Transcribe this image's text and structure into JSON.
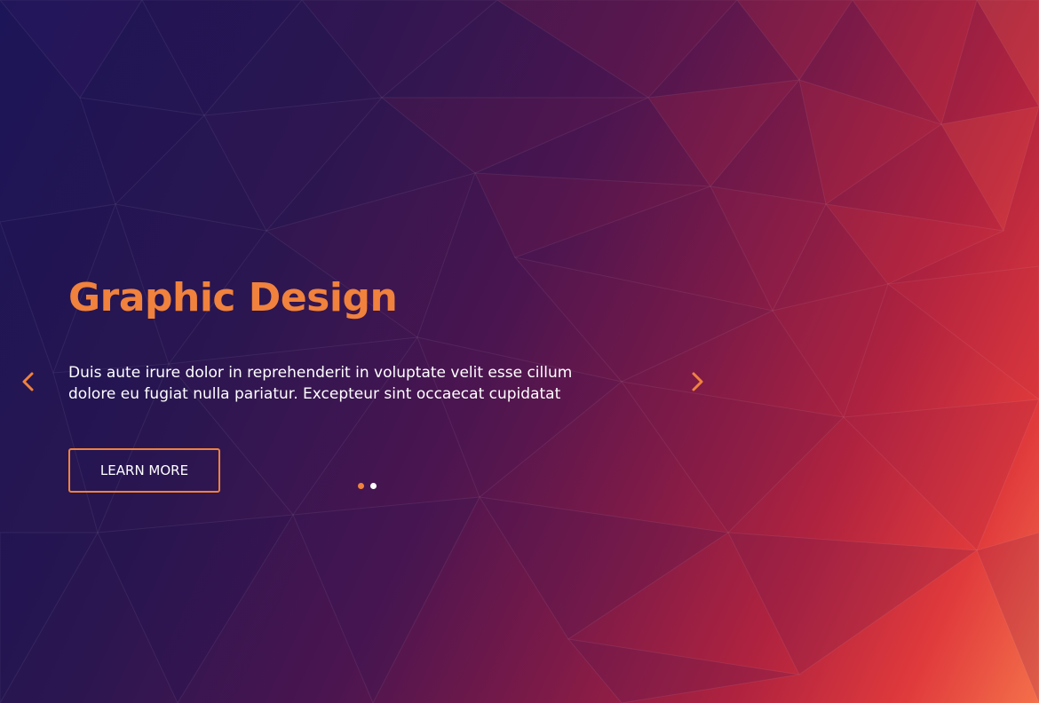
{
  "hero": {
    "title": "Graphic Design",
    "description_line1": "Duis aute irure dolor in reprehenderit in voluptate velit esse cillum",
    "description_line2": "dolore eu fugiat nulla pariatur. Excepteur sint occaecat cupidatat",
    "button_label": "LEARN MORE"
  },
  "carousel": {
    "prev_icon": "chevron-left-icon",
    "next_icon": "chevron-right-icon",
    "slide_count": 2,
    "active_index": 0
  },
  "colors": {
    "accent": "#f0823d",
    "text": "#ffffff",
    "dot_inactive": "#ffffff"
  }
}
